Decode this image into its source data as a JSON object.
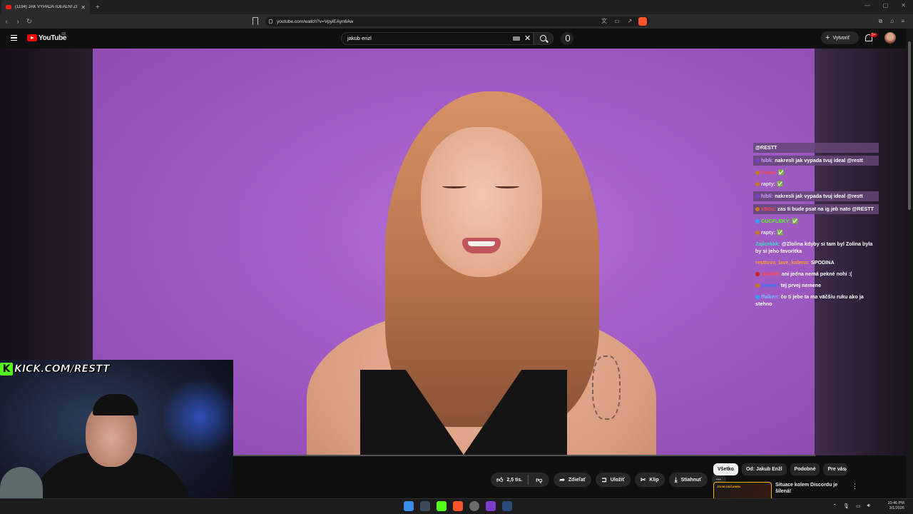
{
  "browser": {
    "tab_title": "(1194) JAK VYPADÁ IDEÁLNÍ ŽEN",
    "url": "youtube.com/watch?v=VpyiEAyn6Aw",
    "new_tab": "+"
  },
  "youtube": {
    "logo_text": "YouTube",
    "country": "SK",
    "search_query": "jakub enzl",
    "create_label": "Vytvoriť",
    "notifications_badge": "9+"
  },
  "chat": [
    {
      "user": "",
      "text": "@RESTT",
      "color": "#ffffff",
      "dot": "",
      "highlight": true
    },
    {
      "user": "hibli:",
      "text": " nakresli jak vypada tvuj ideal @restt",
      "color": "#c9a0ff",
      "dot": "#7a3cc9",
      "highlight": true
    },
    {
      "user": "Freak:",
      "text": " ✅",
      "color": "#ff4a4a",
      "dot": "#c8781e",
      "highlight": false
    },
    {
      "user": "rapty:",
      "text": " ✅",
      "color": "#e8e8e8",
      "dot": "#c8781e",
      "highlight": false
    },
    {
      "user": "hibli:",
      "text": " nakresli jak vypada tvuj ideal @restt",
      "color": "#c9a0ff",
      "dot": "#7a3cc9",
      "highlight": true
    },
    {
      "user": "xSGu:",
      "text": " zas ti bude psat na ig jeb nato @RESTT",
      "color": "#ff4a4a",
      "dot": "#c8781e",
      "highlight": true
    },
    {
      "user": "CUCFLEKY:",
      "text": " ✅",
      "color": "#53fc18",
      "dot": "#2aa3ff",
      "highlight": false
    },
    {
      "user": "rapty:",
      "text": " ✅",
      "color": "#e8e8e8",
      "dot": "#c8781e",
      "highlight": false
    },
    {
      "user": "Zajicekkk:",
      "text": " @Zlolina kdyby si tam byl Zolina byla by si jeho favoritka",
      "color": "#3fd9c8",
      "dot": "",
      "highlight": false
    },
    {
      "user": "resttovo_lave_koleno:",
      "text": " SPODINA",
      "color": "#ff9a3c",
      "dot": "",
      "highlight": false
    },
    {
      "user": "cislo85:",
      "text": " ani jedna nemá pekné nohi :(",
      "color": "#ff4a4a",
      "dot": "#d02020",
      "highlight": false
    },
    {
      "user": "Xamek:",
      "text": " tej prvej nemene",
      "color": "#2a7bff",
      "dot": "#c8781e",
      "highlight": false
    },
    {
      "user": "ffalken:",
      "text": " čo ti jebe ta ma väčšiu ruku ako ja stehno",
      "color": "#7ab8ff",
      "dot": "#2aa3ff",
      "highlight": false
    }
  ],
  "webcam": {
    "kick_logo": "K",
    "kick_text": "KICK.COM/RESTT"
  },
  "actions": {
    "likes": "2,5 tis.",
    "share": "Zdieľať",
    "save": "Uložiť",
    "clip": "Klip",
    "download": "Stiahnuť"
  },
  "chips": [
    "Všetko",
    "Od: Jakub Enžl",
    "Podobné",
    "Pre vás"
  ],
  "recommendation": {
    "title": "Situace kolem Discordu je šílená!",
    "thumb_text": "JSI MI ODČANEN"
  },
  "taskbar": {
    "time": "10:46 PM",
    "date": "3/1/2026"
  },
  "colors": {
    "youtube_red": "#ff0000",
    "kick_green": "#53fc18",
    "video_bg": "#a35dc8"
  }
}
